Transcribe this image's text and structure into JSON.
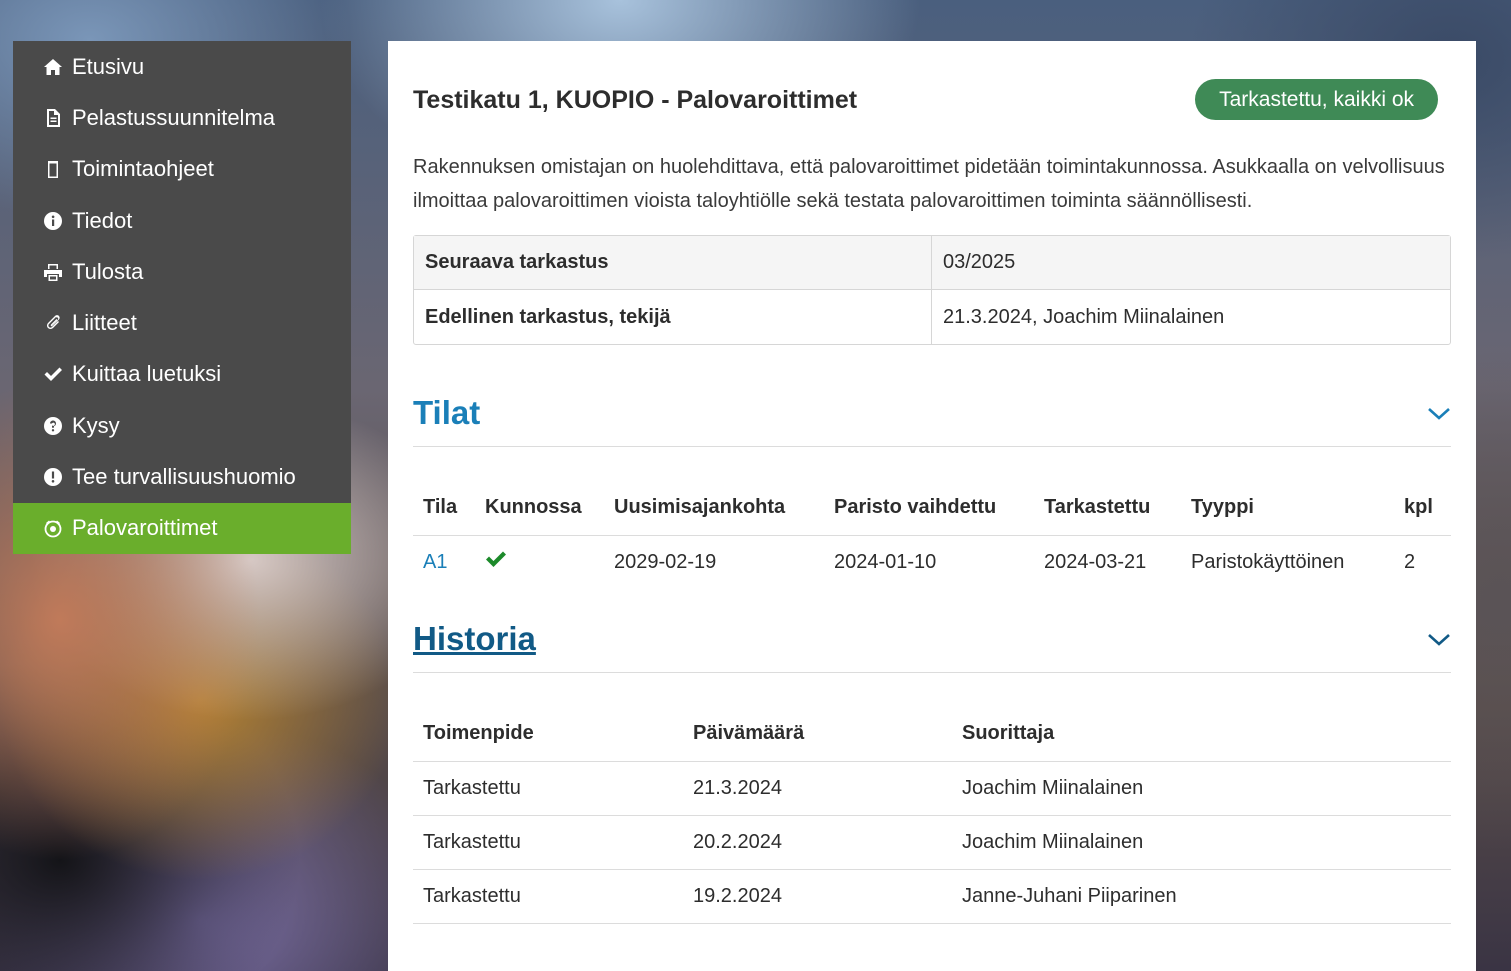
{
  "sidebar": {
    "items": [
      {
        "label": "Etusivu",
        "icon": "home-icon",
        "active": false
      },
      {
        "label": "Pelastussuunnitelma",
        "icon": "document-icon",
        "active": false
      },
      {
        "label": "Toimintaohjeet",
        "icon": "clipboard-icon",
        "active": false
      },
      {
        "label": "Tiedot",
        "icon": "info-icon",
        "active": false
      },
      {
        "label": "Tulosta",
        "icon": "print-icon",
        "active": false
      },
      {
        "label": "Liitteet",
        "icon": "paperclip-icon",
        "active": false
      },
      {
        "label": "Kuittaa luetuksi",
        "icon": "check-icon",
        "active": false
      },
      {
        "label": "Kysy",
        "icon": "question-icon",
        "active": false
      },
      {
        "label": "Tee turvallisuushuomio",
        "icon": "exclamation-icon",
        "active": false
      },
      {
        "label": "Palovaroittimet",
        "icon": "smoke-detector-icon",
        "active": true
      }
    ]
  },
  "main": {
    "title": "Testikatu 1, KUOPIO - Palovaroittimet",
    "status_badge": "Tarkastettu, kaikki ok",
    "intro": "Rakennuksen omistajan on huolehdittava, että palovaroittimet pidetään toimintakunnossa. Asukkaalla on velvollisuus ilmoittaa palovaroittimen vioista taloyhtiölle sekä testata palovaroittimen toiminta säännöllisesti.",
    "info": [
      {
        "label": "Seuraava tarkastus",
        "value": "03/2025"
      },
      {
        "label": "Edellinen tarkastus, tekijä",
        "value": "21.3.2024, Joachim Miinalainen"
      }
    ]
  },
  "spaces": {
    "heading": "Tilat",
    "columns": [
      "Tila",
      "Kunnossa",
      "Uusimisajankohta",
      "Paristo vaihdettu",
      "Tarkastettu",
      "Tyyppi",
      "kpl"
    ],
    "rows": [
      {
        "tila": "A1",
        "kunnossa": true,
        "uusimisajankohta": "2029-02-19",
        "paristo_vaihdettu": "2024-01-10",
        "tarkastettu": "2024-03-21",
        "tyyppi": "Paristokäyttöinen",
        "kpl": "2"
      }
    ]
  },
  "history": {
    "heading": "Historia",
    "columns": [
      "Toimenpide",
      "Päivämäärä",
      "Suorittaja"
    ],
    "rows": [
      {
        "toimenpide": "Tarkastettu",
        "paivamaara": "21.3.2024",
        "suorittaja": "Joachim Miinalainen"
      },
      {
        "toimenpide": "Tarkastettu",
        "paivamaara": "20.2.2024",
        "suorittaja": "Joachim Miinalainen"
      },
      {
        "toimenpide": "Tarkastettu",
        "paivamaara": "19.2.2024",
        "suorittaja": "Janne-Juhani Piiparinen"
      }
    ]
  },
  "colors": {
    "sidebar_bg": "#4a4a4a",
    "active_item": "#6aae2c",
    "badge": "#3f8a56",
    "link": "#1a7fb8",
    "check": "#1c8a2a"
  }
}
